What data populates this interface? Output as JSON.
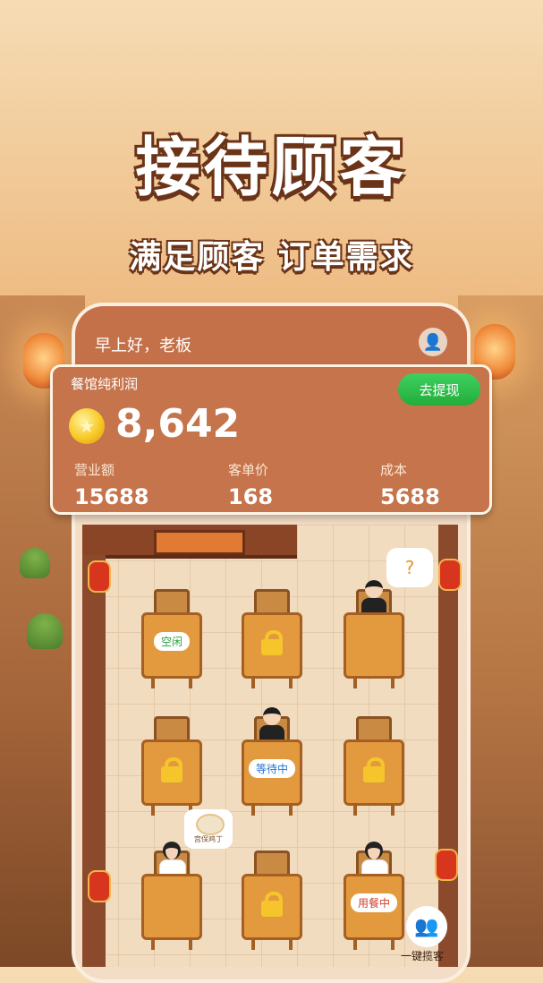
{
  "headline": {
    "title": "接待顾客",
    "subtitle": "满足顾客 订单需求"
  },
  "header": {
    "greeting": "早上好，老板",
    "avatar_icon": "user-icon"
  },
  "profit_card": {
    "label": "餐馆纯利润",
    "withdraw_label": "去提现",
    "amount": "8,642",
    "stats": [
      {
        "label": "营业额",
        "value": "15688"
      },
      {
        "label": "客单价",
        "value": "168"
      },
      {
        "label": "成本",
        "value": "5688"
      }
    ]
  },
  "tables": [
    {
      "state": "idle",
      "status_text": "空闲"
    },
    {
      "state": "locked"
    },
    {
      "state": "occupied"
    },
    {
      "state": "locked"
    },
    {
      "state": "waiting",
      "status_text": "等待中"
    },
    {
      "state": "locked"
    },
    {
      "state": "occupied"
    },
    {
      "state": "locked"
    },
    {
      "state": "eating",
      "status_text": "用餐中"
    }
  ],
  "order_bubble": {
    "text": "?"
  },
  "dish_bubble": {
    "name": "宫保鸡丁"
  },
  "invite": {
    "label": "一键揽客",
    "icon": "group-icon"
  },
  "colors": {
    "accent": "#c5744c",
    "withdraw": "#22ad3c",
    "coin": "#f8c826"
  }
}
